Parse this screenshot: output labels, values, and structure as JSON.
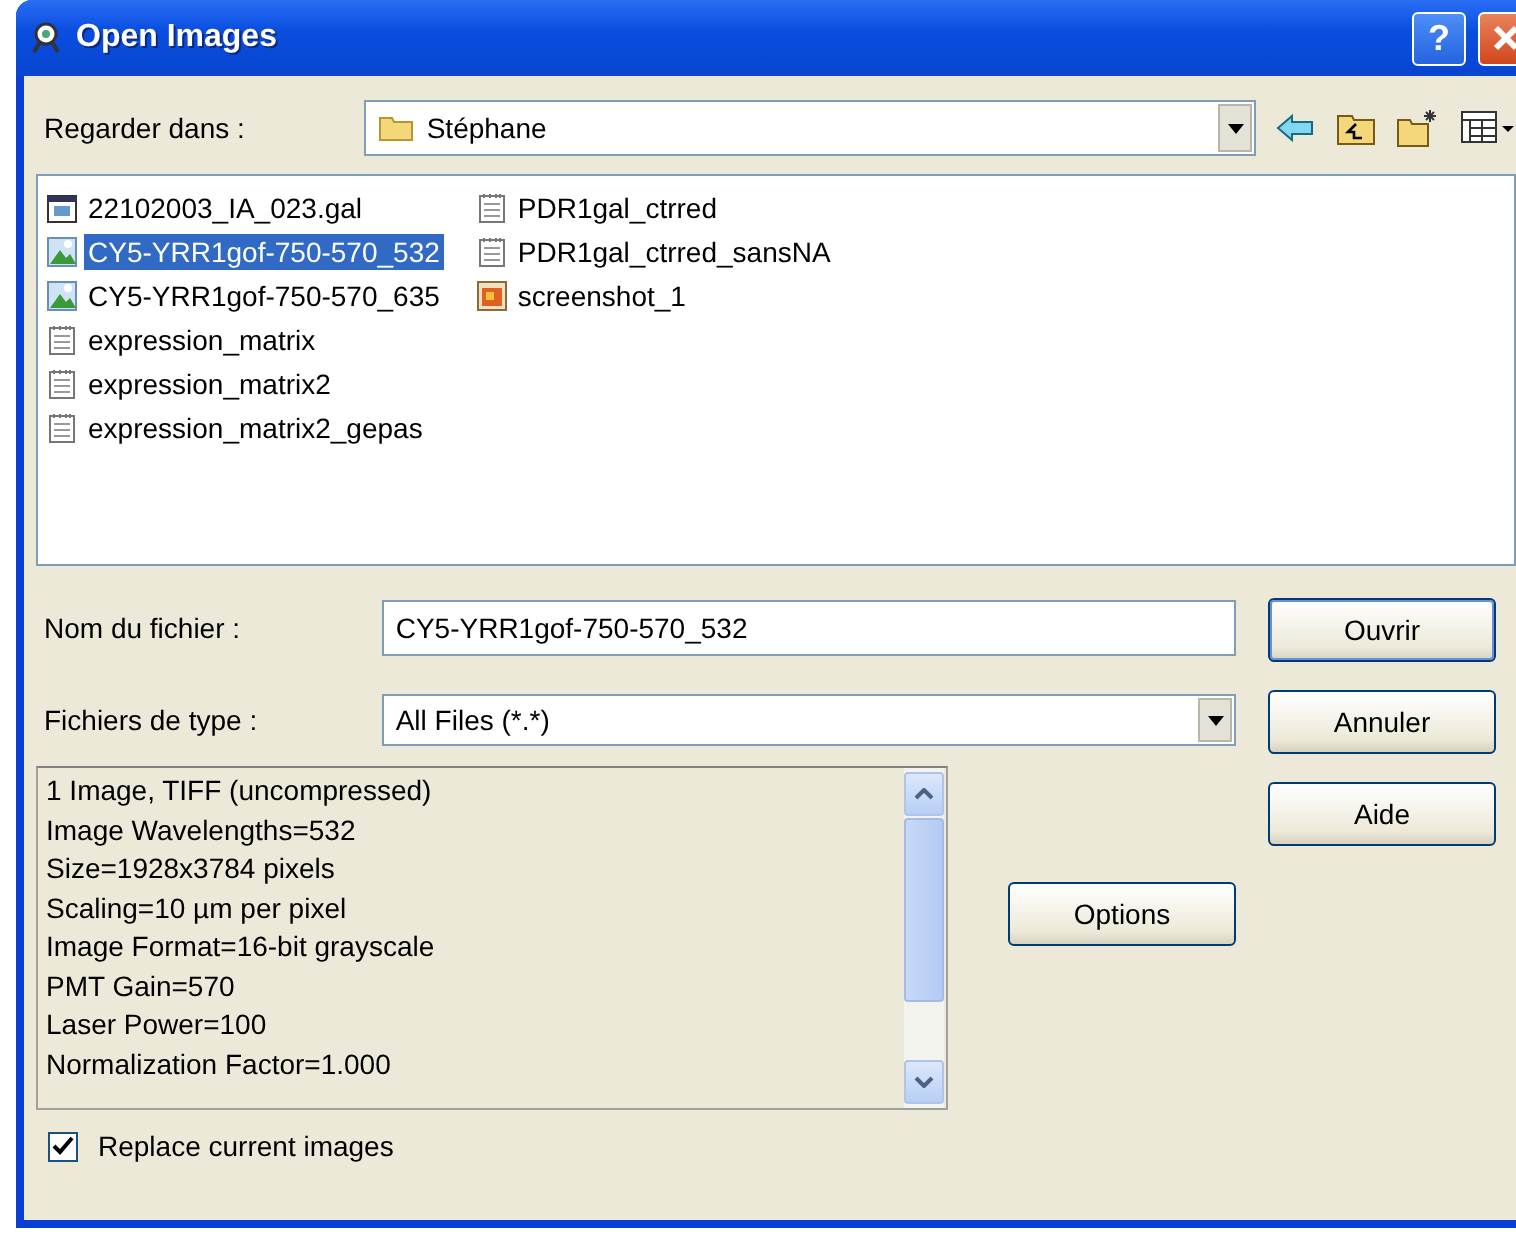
{
  "window": {
    "title": "Open Images",
    "help_button": "?"
  },
  "look_in": {
    "label": "Regarder dans :",
    "value": "Stéphane"
  },
  "files": [
    {
      "name": "22102003_IA_023.gal",
      "kind": "gal",
      "selected": false
    },
    {
      "name": "CY5-YRR1gof-750-570_532",
      "kind": "image",
      "selected": true
    },
    {
      "name": "CY5-YRR1gof-750-570_635",
      "kind": "image",
      "selected": false
    },
    {
      "name": "expression_matrix",
      "kind": "text",
      "selected": false
    },
    {
      "name": "expression_matrix2",
      "kind": "text",
      "selected": false
    },
    {
      "name": "expression_matrix2_gepas",
      "kind": "text",
      "selected": false
    },
    {
      "name": "PDR1gal_ctrred",
      "kind": "text",
      "selected": false
    },
    {
      "name": "PDR1gal_ctrred_sansNA",
      "kind": "text",
      "selected": false
    },
    {
      "name": "screenshot_1",
      "kind": "picture",
      "selected": false
    }
  ],
  "file_name": {
    "label": "Nom du fichier :",
    "value": "CY5-YRR1gof-750-570_532"
  },
  "file_type": {
    "label": "Fichiers de type :",
    "value": "All Files (*.*)"
  },
  "info_lines": [
    "1 Image, TIFF (uncompressed)",
    "Image Wavelengths=532",
    "Size=1928x3784 pixels",
    "Scaling=10 µm per pixel",
    "Image Format=16-bit grayscale",
    "PMT Gain=570",
    "Laser Power=100",
    "Normalization Factor=1.000"
  ],
  "buttons": {
    "open": "Ouvrir",
    "cancel": "Annuler",
    "help": "Aide",
    "options": "Options"
  },
  "replace_checkbox": {
    "label": "Replace current images",
    "checked": true
  }
}
